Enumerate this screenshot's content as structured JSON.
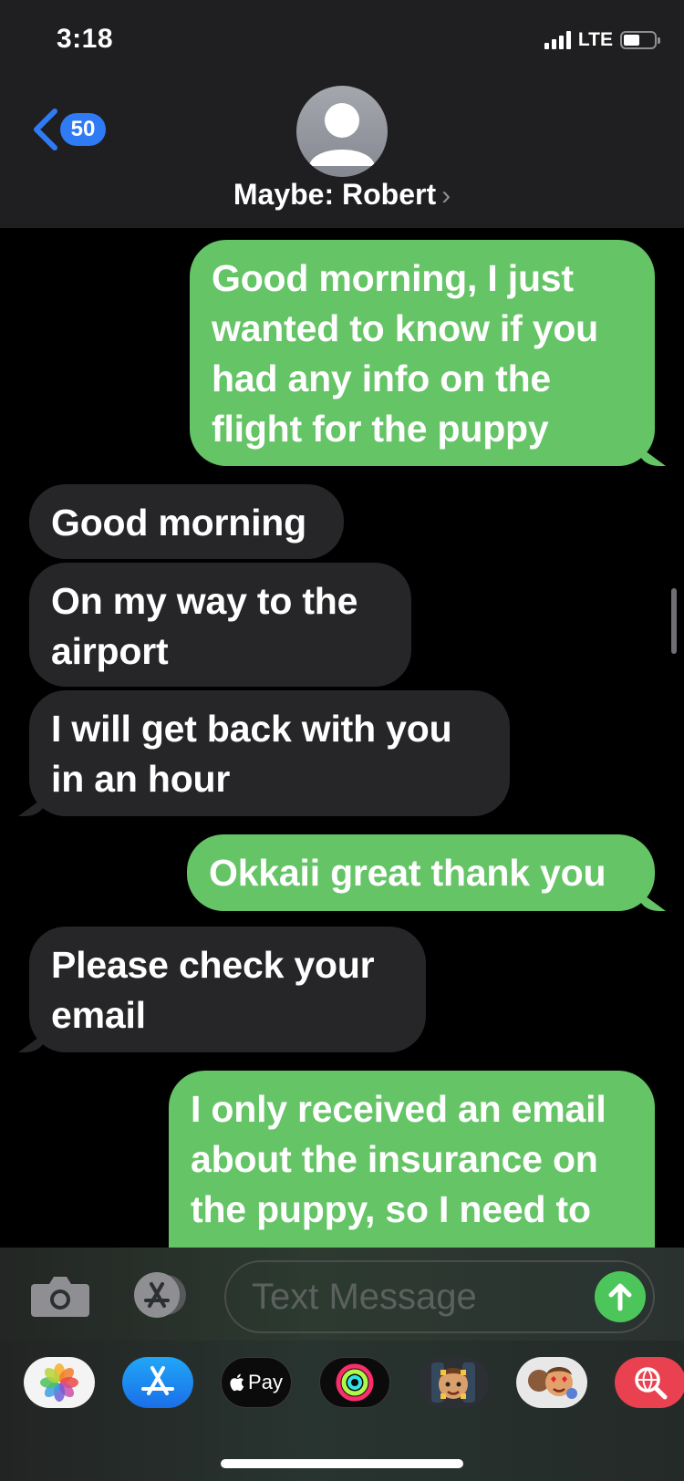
{
  "status_bar": {
    "time": "3:18",
    "network": "LTE"
  },
  "header": {
    "back_count": "50",
    "contact_name": "Maybe: Robert",
    "name_chevron": "›"
  },
  "messages": [
    {
      "direction": "sent",
      "text": "Good morning, I just\nwanted to know if you\nhad any info on the\nflight for the puppy"
    },
    {
      "direction": "received",
      "text": "Good morning"
    },
    {
      "direction": "received",
      "text": "On my way to the\nairport"
    },
    {
      "direction": "received",
      "text": "I will get back with you\nin an hour"
    },
    {
      "direction": "sent",
      "text": "Okkaii great thank you"
    },
    {
      "direction": "received",
      "text": "Please check your\nemail"
    },
    {
      "direction": "sent",
      "text": "I only received an email\nabout the insurance on\nthe puppy, so I need to"
    }
  ],
  "composer": {
    "placeholder": "Text Message"
  },
  "apps": [
    {
      "name": "photos",
      "label": ""
    },
    {
      "name": "app-store",
      "label": ""
    },
    {
      "name": "apple-pay",
      "label": "Pay"
    },
    {
      "name": "fitness",
      "label": ""
    },
    {
      "name": "memoji-1",
      "label": ""
    },
    {
      "name": "memoji-2",
      "label": ""
    },
    {
      "name": "images-search",
      "label": ""
    }
  ],
  "colors": {
    "sent": "#65c466",
    "received": "#262628",
    "accent": "#2f7bf5"
  }
}
